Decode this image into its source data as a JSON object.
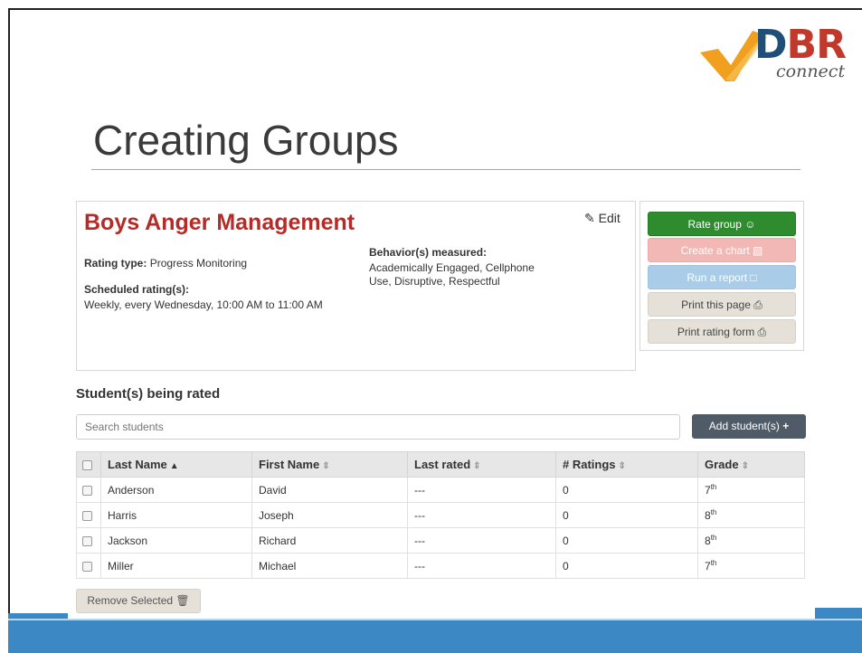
{
  "slide": {
    "title": "Creating Groups"
  },
  "logo": {
    "letters_1": "D",
    "letters_2": "BR",
    "sub": "connect",
    "colors": {
      "check": "#f0a01e",
      "navy": "#1f4e79",
      "red": "#c0392b"
    }
  },
  "group": {
    "name": "Boys Anger Management",
    "edit_label": "Edit",
    "rating_type_label": "Rating type:",
    "rating_type_value": "Progress Monitoring",
    "scheduled_label": "Scheduled rating(s):",
    "scheduled_value": "Weekly, every Wednesday, 10:00 AM to 11:00 AM",
    "behaviors_label": "Behavior(s) measured:",
    "behaviors_value": "Academically Engaged, Cellphone Use, Disruptive, Respectful"
  },
  "actions": {
    "rate_group": "Rate group",
    "create_chart": "Create a chart",
    "run_report": "Run a report",
    "print_page": "Print this page",
    "print_form": "Print rating form"
  },
  "students_section": {
    "heading": "Student(s) being rated",
    "search_placeholder": "Search students",
    "add_button": "Add student(s)",
    "remove_button": "Remove Selected"
  },
  "table": {
    "headers": {
      "last_name": "Last Name",
      "first_name": "First Name",
      "last_rated": "Last rated",
      "num_ratings": "# Ratings",
      "grade": "Grade"
    },
    "rows": [
      {
        "last": "Anderson",
        "first": "David",
        "last_rated": "---",
        "ratings": "0",
        "grade": "7",
        "grade_sup": "th"
      },
      {
        "last": "Harris",
        "first": "Joseph",
        "last_rated": "---",
        "ratings": "0",
        "grade": "8",
        "grade_sup": "th"
      },
      {
        "last": "Jackson",
        "first": "Richard",
        "last_rated": "---",
        "ratings": "0",
        "grade": "8",
        "grade_sup": "th"
      },
      {
        "last": "Miller",
        "first": "Michael",
        "last_rated": "---",
        "ratings": "0",
        "grade": "7",
        "grade_sup": "th"
      }
    ]
  }
}
